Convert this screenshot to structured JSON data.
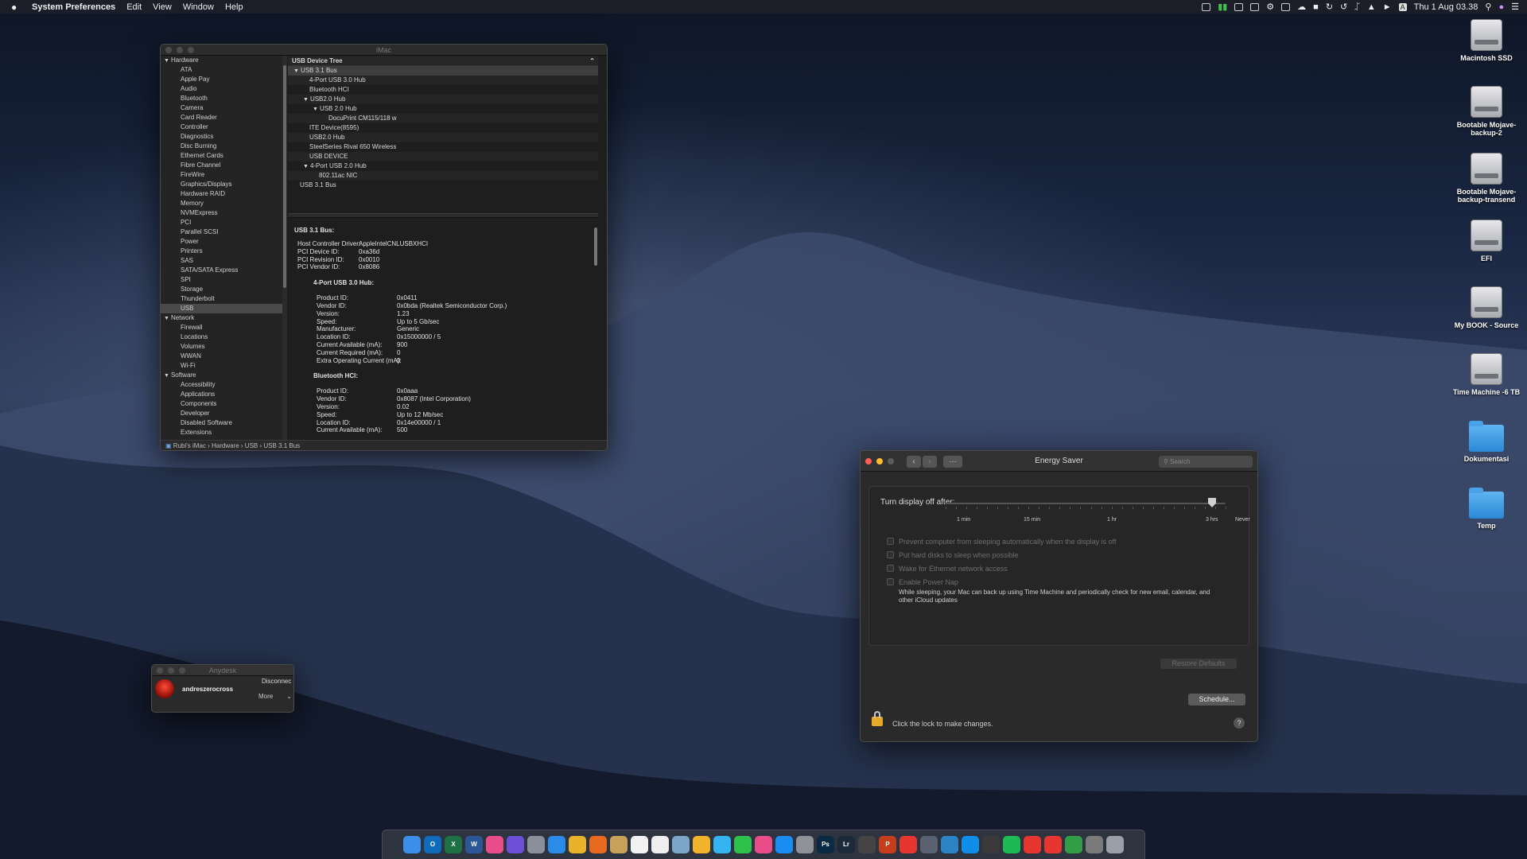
{
  "menubar": {
    "app": "System Preferences",
    "items": [
      "Edit",
      "View",
      "Window",
      "Help"
    ],
    "input_indicator": "A",
    "clock": "Thu 1 Aug  03.38"
  },
  "desktop_icons": [
    {
      "label": "Macintosh SSD",
      "type": "drive"
    },
    {
      "label": "Bootable Mojave-backup-2",
      "type": "drive"
    },
    {
      "label": "Bootable Mojave-backup-transend",
      "type": "drive"
    },
    {
      "label": "EFI",
      "type": "drive"
    },
    {
      "label": "My BOOK - Source",
      "type": "drive"
    },
    {
      "label": "Time Machine -6 TB",
      "type": "drive"
    },
    {
      "label": "Dokumentasi",
      "type": "folder"
    },
    {
      "label": "Temp",
      "type": "folder"
    }
  ],
  "sysinfo": {
    "title": "iMac",
    "sidebar": [
      {
        "label": "Hardware",
        "kind": "cat"
      },
      {
        "label": "ATA"
      },
      {
        "label": "Apple Pay"
      },
      {
        "label": "Audio"
      },
      {
        "label": "Bluetooth"
      },
      {
        "label": "Camera"
      },
      {
        "label": "Card Reader"
      },
      {
        "label": "Controller"
      },
      {
        "label": "Diagnostics"
      },
      {
        "label": "Disc Burning"
      },
      {
        "label": "Ethernet Cards"
      },
      {
        "label": "Fibre Channel"
      },
      {
        "label": "FireWire"
      },
      {
        "label": "Graphics/Displays"
      },
      {
        "label": "Hardware RAID"
      },
      {
        "label": "Memory"
      },
      {
        "label": "NVMExpress"
      },
      {
        "label": "PCI"
      },
      {
        "label": "Parallel SCSI"
      },
      {
        "label": "Power"
      },
      {
        "label": "Printers"
      },
      {
        "label": "SAS"
      },
      {
        "label": "SATA/SATA Express"
      },
      {
        "label": "SPI"
      },
      {
        "label": "Storage"
      },
      {
        "label": "Thunderbolt"
      },
      {
        "label": "USB",
        "selected": true
      },
      {
        "label": "Network",
        "kind": "cat"
      },
      {
        "label": "Firewall"
      },
      {
        "label": "Locations"
      },
      {
        "label": "Volumes"
      },
      {
        "label": "WWAN"
      },
      {
        "label": "Wi-Fi"
      },
      {
        "label": "Software",
        "kind": "cat"
      },
      {
        "label": "Accessibility"
      },
      {
        "label": "Applications"
      },
      {
        "label": "Components"
      },
      {
        "label": "Developer"
      },
      {
        "label": "Disabled Software"
      },
      {
        "label": "Extensions"
      }
    ],
    "tree_header": "USB Device Tree",
    "tree": [
      {
        "label": "USB 3.1 Bus",
        "indent": 0,
        "disclosure": true,
        "selected": true
      },
      {
        "label": "4-Port USB 3.0 Hub",
        "indent": 1
      },
      {
        "label": "Bluetooth HCI",
        "indent": 1
      },
      {
        "label": "USB2.0 Hub",
        "indent": 1,
        "disclosure": true
      },
      {
        "label": "USB 2.0 Hub",
        "indent": 2,
        "disclosure": true
      },
      {
        "label": "DocuPrint CM115/118 w",
        "indent": 3
      },
      {
        "label": "ITE Device(8595)",
        "indent": 1
      },
      {
        "label": "USB2.0 Hub",
        "indent": 1
      },
      {
        "label": "SteelSeries Rival 650 Wireless",
        "indent": 1
      },
      {
        "label": "USB DEVICE",
        "indent": 1
      },
      {
        "label": "4-Port USB 2.0 Hub",
        "indent": 1,
        "disclosure": true
      },
      {
        "label": "802.11ac NIC",
        "indent": 2
      },
      {
        "label": "USB 3.1 Bus",
        "indent": 0
      }
    ],
    "detail": {
      "heading": "USB 3.1 Bus:",
      "bus": [
        [
          "Host Controller Driver:",
          "AppleIntelCNLUSBXHCI"
        ],
        [
          "PCI Device ID:",
          "0xa36d"
        ],
        [
          "PCI Revision ID:",
          "0x0010"
        ],
        [
          "PCI Vendor ID:",
          "0x8086"
        ]
      ],
      "hub_heading": "4-Port USB 3.0 Hub:",
      "hub": [
        [
          "Product ID:",
          "0x0411"
        ],
        [
          "Vendor ID:",
          "0x0bda  (Realtek Semiconductor Corp.)"
        ],
        [
          "Version:",
          "1.23"
        ],
        [
          "Speed:",
          "Up to 5 Gb/sec"
        ],
        [
          "Manufacturer:",
          "Generic"
        ],
        [
          "Location ID:",
          "0x15000000 / 5"
        ],
        [
          "Current Available (mA):",
          "900"
        ],
        [
          "Current Required (mA):",
          "0"
        ],
        [
          "Extra Operating Current (mA):",
          "0"
        ]
      ],
      "bt_heading": "Bluetooth HCI:",
      "bt": [
        [
          "Product ID:",
          "0x0aaa"
        ],
        [
          "Vendor ID:",
          "0x8087  (Intel Corporation)"
        ],
        [
          "Version:",
          "0.02"
        ],
        [
          "Speed:",
          "Up to 12 Mb/sec"
        ],
        [
          "Location ID:",
          "0x14e00000 / 1"
        ],
        [
          "Current Available (mA):",
          "500"
        ]
      ]
    },
    "path": "Rubi's iMac  ›  Hardware  ›  USB  ›  USB 3.1 Bus"
  },
  "energy": {
    "title": "Energy Saver",
    "search_placeholder": "Search",
    "slider_label": "Turn display off after:",
    "slider_value": "3 hrs",
    "ticks": [
      "1 min",
      "15 min",
      "1 hr",
      "3 hrs",
      "Never"
    ],
    "options": [
      "Prevent computer from sleeping automatically when the display is off",
      "Put hard disks to sleep when possible",
      "Wake for Ethernet network access",
      "Enable Power Nap"
    ],
    "power_nap_desc": "While sleeping, your Mac can back up using Time Machine and periodically check for new email, calendar, and other iCloud updates",
    "restore": "Restore Defaults",
    "schedule": "Schedule...",
    "lock_text": "Click the lock to make changes.",
    "help": "?"
  },
  "anydesk": {
    "title": "Anydesk",
    "user": "andreszerocross",
    "disconnect": "Disconnec",
    "more": "More"
  },
  "dock": [
    {
      "name": "finder",
      "color": "#3b8fe8"
    },
    {
      "name": "outlook",
      "color": "#0f6cbd",
      "text": "O"
    },
    {
      "name": "excel",
      "color": "#1e7145",
      "text": "X"
    },
    {
      "name": "word",
      "color": "#2b5797",
      "text": "W"
    },
    {
      "name": "gitkraken",
      "color": "#e84d8a"
    },
    {
      "name": "siri",
      "color": "#6b4fd6"
    },
    {
      "name": "launchpad",
      "color": "#8b8f9a"
    },
    {
      "name": "safari",
      "color": "#2a8ce8"
    },
    {
      "name": "chrome",
      "color": "#e8b32a"
    },
    {
      "name": "firefox",
      "color": "#e86a1e"
    },
    {
      "name": "notes",
      "color": "#c8a15a"
    },
    {
      "name": "calendar",
      "color": "#f2f2f2"
    },
    {
      "name": "reminders",
      "color": "#eeeeee"
    },
    {
      "name": "preview",
      "color": "#7da7c9"
    },
    {
      "name": "photos",
      "color": "#f0b32a"
    },
    {
      "name": "messages",
      "color": "#35b4f2"
    },
    {
      "name": "facetime",
      "color": "#2fc24b"
    },
    {
      "name": "itunes",
      "color": "#ea4c89"
    },
    {
      "name": "app-store",
      "color": "#1b8df2"
    },
    {
      "name": "system-preferences",
      "color": "#8f9399"
    },
    {
      "name": "photoshop",
      "color": "#0a2a44",
      "text": "Ps"
    },
    {
      "name": "lightroom",
      "color": "#1c2a3a",
      "text": "Lr"
    },
    {
      "name": "final-cut",
      "color": "#444"
    },
    {
      "name": "powerpoint",
      "color": "#c43e1c",
      "text": "P"
    },
    {
      "name": "anydesk",
      "color": "#e7362f"
    },
    {
      "name": "utility",
      "color": "#5a6170"
    },
    {
      "name": "vpn",
      "color": "#2d84c4"
    },
    {
      "name": "teamviewer",
      "color": "#0e8ee9"
    },
    {
      "name": "activity-monitor",
      "color": "#3a3a3a"
    },
    {
      "name": "spotify",
      "color": "#1db954"
    },
    {
      "name": "remote",
      "color": "#e7362f"
    },
    {
      "name": "remote-2",
      "color": "#e7362f"
    },
    {
      "name": "network",
      "color": "#2f9e44"
    },
    {
      "name": "automator",
      "color": "#7a7a7a"
    },
    {
      "name": "trash",
      "color": "#9aa0a8"
    }
  ]
}
